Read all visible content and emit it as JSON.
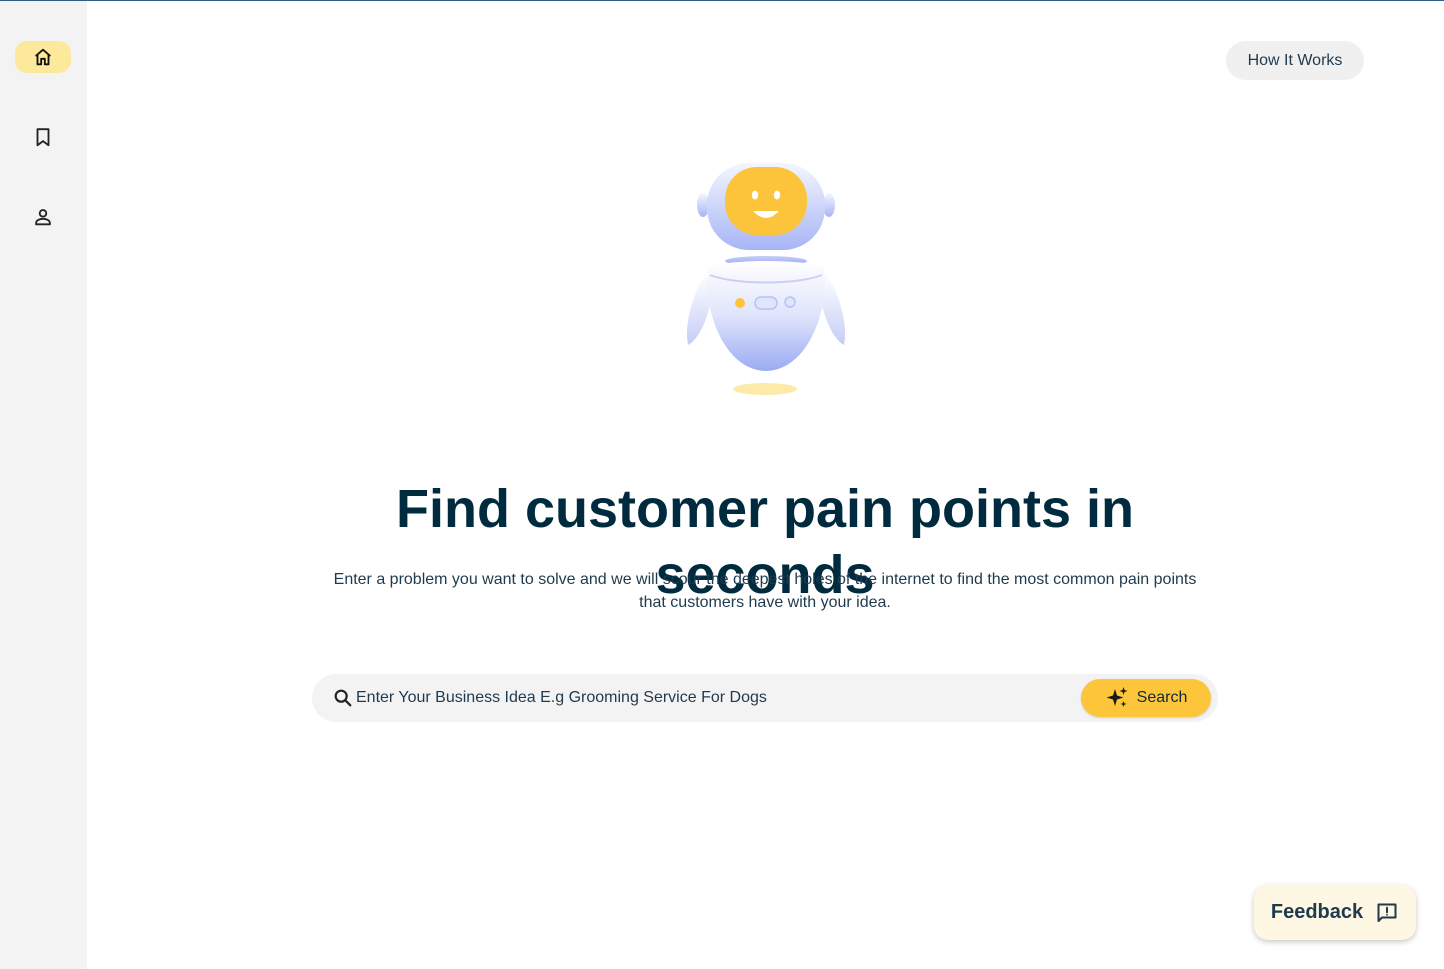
{
  "sidebar": {
    "items": [
      {
        "name": "home",
        "icon": "home-icon",
        "active": true
      },
      {
        "name": "saved",
        "icon": "bookmark-icon",
        "active": false
      },
      {
        "name": "profile",
        "icon": "person-icon",
        "active": false
      }
    ]
  },
  "header": {
    "how_it_works_label": "How It Works"
  },
  "hero": {
    "illustration": "robot-mascot",
    "title": "Find customer pain points in seconds",
    "subtitle_line1": "Enter a problem you want to solve and we will scour the deepest holes of the internet to find the most common pain points",
    "subtitle_line2": "that customers have with your idea."
  },
  "search": {
    "placeholder": "Enter Your Business Idea E.g Grooming Service For Dogs",
    "value": "",
    "button_label": "Search",
    "button_icon": "sparkle-icon"
  },
  "feedback": {
    "label": "Feedback",
    "icon": "feedback-icon"
  },
  "colors": {
    "accent": "#fcc53a",
    "active_nav": "#fde99b",
    "heading": "#002b3e",
    "sidebar_bg": "#f3f3f3"
  }
}
